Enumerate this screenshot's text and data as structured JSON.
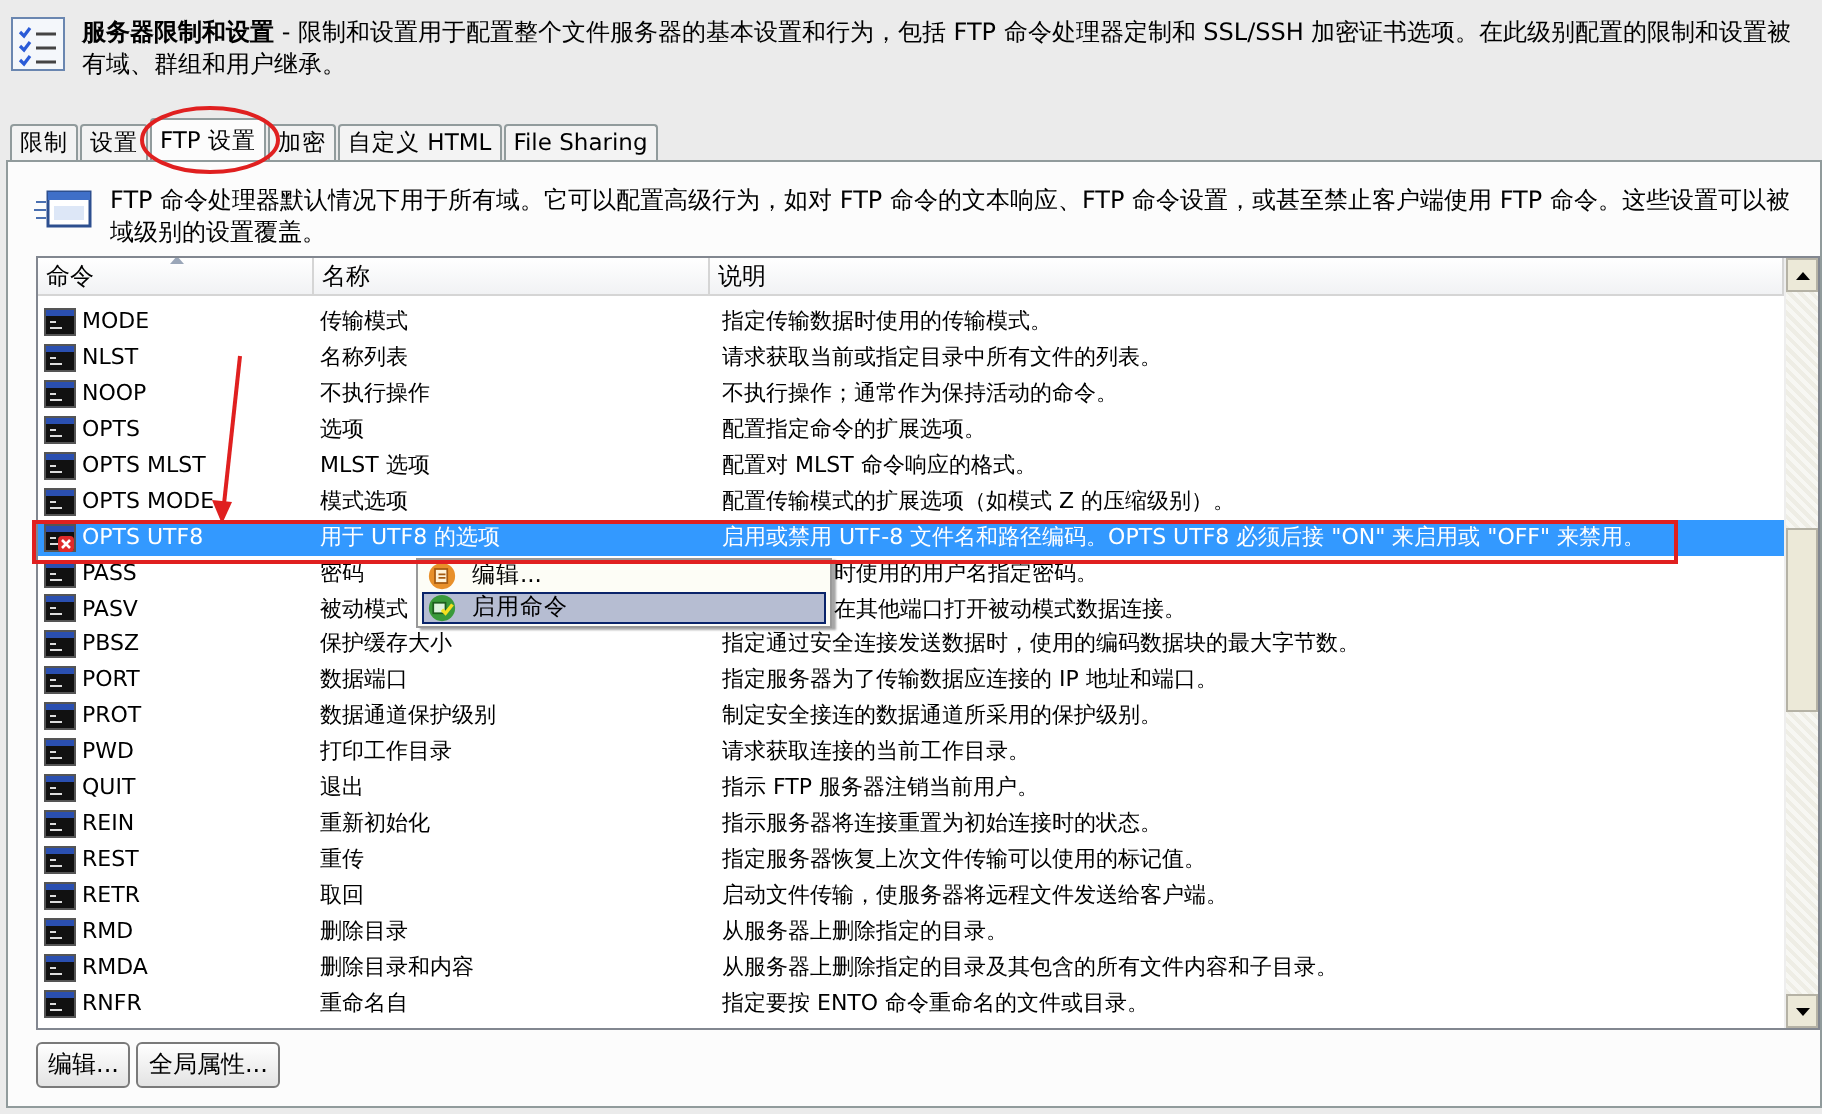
{
  "header": {
    "title_line": "**服务器限制和设置** - 限制和设置用于配置整个文件服务器的基本设置和行为，包括 FTP 命令处理器定制和 SSL/SSH 加密证书选项。在此级别配置的限制和设置被",
    "second_line": "有域、群组和用户继承。"
  },
  "tabs": [
    {
      "label": "限制",
      "selected": false
    },
    {
      "label": "设置",
      "selected": false
    },
    {
      "label": "FTP 设置",
      "selected": true
    },
    {
      "label": "加密",
      "selected": false
    },
    {
      "label": "自定义 HTML",
      "selected": false
    },
    {
      "label": "File Sharing",
      "selected": false
    }
  ],
  "intro": "FTP 命令处理器默认情况下用于所有域。它可以配置高级行为，如对 FTP 命令的文本响应、FTP 命令设置，或甚至禁止客户端使用 FTP 命令。这些设置可以被域级别的设置覆盖。",
  "table": {
    "columns": [
      {
        "label": "命令",
        "sorted": true
      },
      {
        "label": "名称",
        "sorted": false
      },
      {
        "label": "说明",
        "sorted": false
      }
    ],
    "rows": [
      {
        "command": "MODE",
        "name": "传输模式",
        "description": "指定传输数据时使用的传输模式。",
        "disabled": false,
        "selected": false
      },
      {
        "command": "NLST",
        "name": "名称列表",
        "description": "请求获取当前或指定目录中所有文件的列表。",
        "disabled": false,
        "selected": false
      },
      {
        "command": "NOOP",
        "name": "不执行操作",
        "description": "不执行操作；通常作为保持活动的命令。",
        "disabled": false,
        "selected": false
      },
      {
        "command": "OPTS",
        "name": "选项",
        "description": "配置指定命令的扩展选项。",
        "disabled": false,
        "selected": false
      },
      {
        "command": "OPTS MLST",
        "name": "MLST 选项",
        "description": "配置对 MLST 命令响应的格式。",
        "disabled": false,
        "selected": false
      },
      {
        "command": "OPTS MODE",
        "name": "模式选项",
        "description": "配置传输模式的扩展选项（如模式 Z 的压缩级别）。",
        "disabled": false,
        "selected": false
      },
      {
        "command": "OPTS UTF8",
        "name": "用于 UTF8 的选项",
        "description": "启用或禁用 UTF-8 文件名和路径编码。OPTS UTF8 必须后接 \"ON\" 来启用或 \"OFF\" 来禁用。",
        "disabled": true,
        "selected": true
      },
      {
        "command": "PASS",
        "name": "密码",
        "description": "时使用的用户名指定密码。",
        "disabled": false,
        "selected": false,
        "covered": true
      },
      {
        "command": "PASV",
        "name": "被动模式",
        "description": "在其他端口打开被动模式数据连接。",
        "disabled": false,
        "selected": false,
        "covered": true
      },
      {
        "command": "PBSZ",
        "name": "保护缓存大小",
        "description": "指定通过安全连接发送数据时，使用的编码数据块的最大字节数。",
        "disabled": false,
        "selected": false
      },
      {
        "command": "PORT",
        "name": "数据端口",
        "description": "指定服务器为了传输数据应连接的 IP 地址和端口。",
        "disabled": false,
        "selected": false
      },
      {
        "command": "PROT",
        "name": "数据通道保护级别",
        "description": "制定安全接连的数据通道所采用的保护级别。",
        "disabled": false,
        "selected": false
      },
      {
        "command": "PWD",
        "name": "打印工作目录",
        "description": "请求获取连接的当前工作目录。",
        "disabled": false,
        "selected": false
      },
      {
        "command": "QUIT",
        "name": "退出",
        "description": "指示 FTP 服务器注销当前用户。",
        "disabled": false,
        "selected": false
      },
      {
        "command": "REIN",
        "name": "重新初始化",
        "description": "指示服务器将连接重置为初始连接时的状态。",
        "disabled": false,
        "selected": false
      },
      {
        "command": "REST",
        "name": "重传",
        "description": "指定服务器恢复上次文件传输可以使用的标记值。",
        "disabled": false,
        "selected": false
      },
      {
        "command": "RETR",
        "name": "取回",
        "description": "启动文件传输，使服务器将远程文件发送给客户端。",
        "disabled": false,
        "selected": false
      },
      {
        "command": "RMD",
        "name": "删除目录",
        "description": "从服务器上删除指定的目录。",
        "disabled": false,
        "selected": false
      },
      {
        "command": "RMDA",
        "name": "删除目录和内容",
        "description": "从服务器上删除指定的目录及其包含的所有文件内容和子目录。",
        "disabled": false,
        "selected": false
      },
      {
        "command": "RNFR",
        "name": "重命名自",
        "description": "指定要按 ENTO 命令重命名的文件或目录。",
        "disabled": false,
        "selected": false
      }
    ]
  },
  "context_menu": {
    "items": [
      {
        "label": "编辑...",
        "kind": "edit",
        "selected": false
      },
      {
        "label": "启用命令",
        "kind": "enable",
        "selected": true
      }
    ]
  },
  "buttons": [
    "编辑...",
    "全局属性..."
  ]
}
